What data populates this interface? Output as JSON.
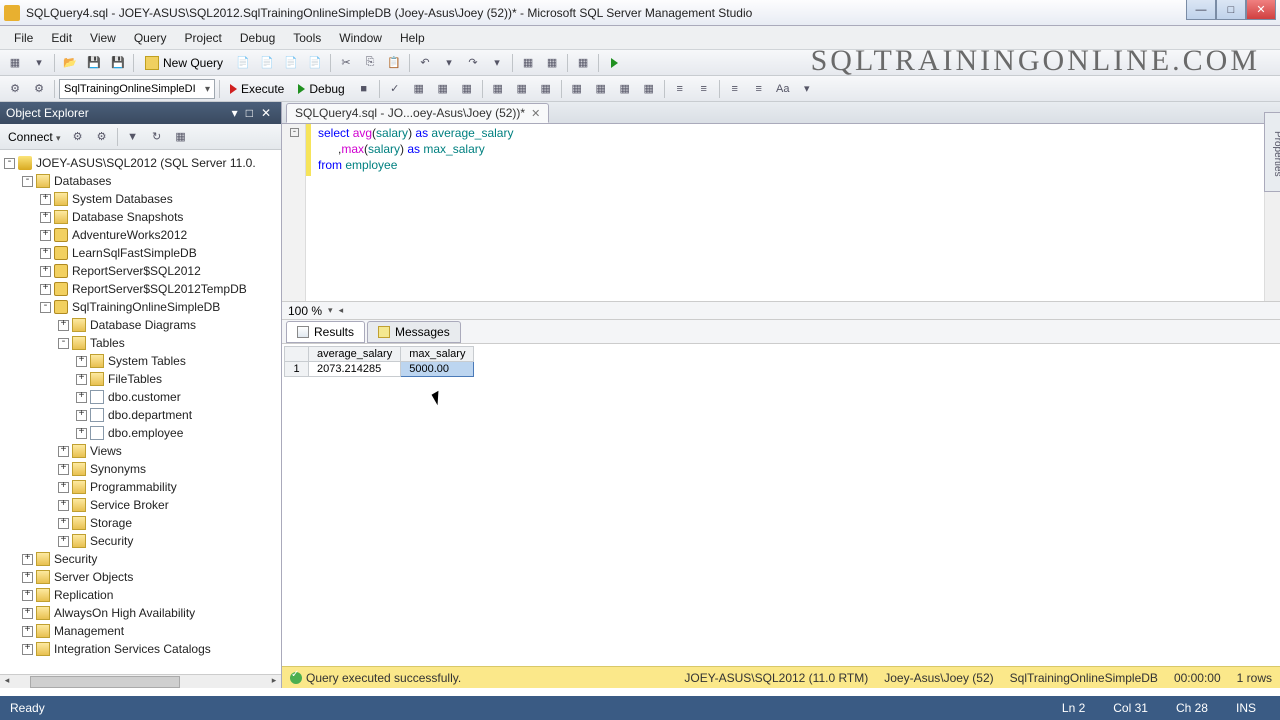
{
  "title": "SQLQuery4.sql - JOEY-ASUS\\SQL2012.SqlTrainingOnlineSimpleDB (Joey-Asus\\Joey (52))* - Microsoft SQL Server Management Studio",
  "menu": {
    "items": [
      "File",
      "Edit",
      "View",
      "Query",
      "Project",
      "Debug",
      "Tools",
      "Window",
      "Help"
    ]
  },
  "toolbar": {
    "new_query": "New Query",
    "db_selected": "SqlTrainingOnlineSimpleDI",
    "execute": "Execute",
    "debug": "Debug"
  },
  "watermark": "SQLTRAININGONLINE.COM",
  "object_explorer": {
    "title": "Object Explorer",
    "connect": "Connect",
    "server": "JOEY-ASUS\\SQL2012 (SQL Server 11.0.",
    "nodes": [
      {
        "depth": 1,
        "exp": "-",
        "ico": "folder",
        "label": "Databases"
      },
      {
        "depth": 2,
        "exp": "+",
        "ico": "folder",
        "label": "System Databases"
      },
      {
        "depth": 2,
        "exp": "+",
        "ico": "folder",
        "label": "Database Snapshots"
      },
      {
        "depth": 2,
        "exp": "+",
        "ico": "db",
        "label": "AdventureWorks2012"
      },
      {
        "depth": 2,
        "exp": "+",
        "ico": "db",
        "label": "LearnSqlFastSimpleDB"
      },
      {
        "depth": 2,
        "exp": "+",
        "ico": "db",
        "label": "ReportServer$SQL2012"
      },
      {
        "depth": 2,
        "exp": "+",
        "ico": "db",
        "label": "ReportServer$SQL2012TempDB"
      },
      {
        "depth": 2,
        "exp": "-",
        "ico": "db",
        "label": "SqlTrainingOnlineSimpleDB"
      },
      {
        "depth": 3,
        "exp": "+",
        "ico": "folder",
        "label": "Database Diagrams"
      },
      {
        "depth": 3,
        "exp": "-",
        "ico": "folder",
        "label": "Tables"
      },
      {
        "depth": 4,
        "exp": "+",
        "ico": "folder",
        "label": "System Tables"
      },
      {
        "depth": 4,
        "exp": "+",
        "ico": "folder",
        "label": "FileTables"
      },
      {
        "depth": 4,
        "exp": "+",
        "ico": "table",
        "label": "dbo.customer"
      },
      {
        "depth": 4,
        "exp": "+",
        "ico": "table",
        "label": "dbo.department"
      },
      {
        "depth": 4,
        "exp": "+",
        "ico": "table",
        "label": "dbo.employee"
      },
      {
        "depth": 3,
        "exp": "+",
        "ico": "folder",
        "label": "Views"
      },
      {
        "depth": 3,
        "exp": "+",
        "ico": "folder",
        "label": "Synonyms"
      },
      {
        "depth": 3,
        "exp": "+",
        "ico": "folder",
        "label": "Programmability"
      },
      {
        "depth": 3,
        "exp": "+",
        "ico": "folder",
        "label": "Service Broker"
      },
      {
        "depth": 3,
        "exp": "+",
        "ico": "folder",
        "label": "Storage"
      },
      {
        "depth": 3,
        "exp": "+",
        "ico": "folder",
        "label": "Security"
      },
      {
        "depth": 1,
        "exp": "+",
        "ico": "folder",
        "label": "Security"
      },
      {
        "depth": 1,
        "exp": "+",
        "ico": "folder",
        "label": "Server Objects"
      },
      {
        "depth": 1,
        "exp": "+",
        "ico": "folder",
        "label": "Replication"
      },
      {
        "depth": 1,
        "exp": "+",
        "ico": "folder",
        "label": "AlwaysOn High Availability"
      },
      {
        "depth": 1,
        "exp": "+",
        "ico": "folder",
        "label": "Management"
      },
      {
        "depth": 1,
        "exp": "+",
        "ico": "folder",
        "label": "Integration Services Catalogs"
      }
    ]
  },
  "editor": {
    "tab": "SQLQuery4.sql - JO...oey-Asus\\Joey (52))*",
    "zoom": "100 %",
    "lines": [
      [
        {
          "t": "select ",
          "c": "kw"
        },
        {
          "t": "avg",
          "c": "fn"
        },
        {
          "t": "(",
          "c": "pl"
        },
        {
          "t": "salary",
          "c": "id"
        },
        {
          "t": ") ",
          "c": "pl"
        },
        {
          "t": "as ",
          "c": "kw"
        },
        {
          "t": "average_salary",
          "c": "id"
        }
      ],
      [
        {
          "t": "      ,",
          "c": "pl"
        },
        {
          "t": "max",
          "c": "fn"
        },
        {
          "t": "(",
          "c": "pl"
        },
        {
          "t": "salary",
          "c": "id"
        },
        {
          "t": ") ",
          "c": "pl"
        },
        {
          "t": "as ",
          "c": "kw"
        },
        {
          "t": "max_salary",
          "c": "id"
        }
      ],
      [
        {
          "t": "from ",
          "c": "kw"
        },
        {
          "t": "employee",
          "c": "id"
        }
      ]
    ]
  },
  "results": {
    "tab_results": "Results",
    "tab_messages": "Messages",
    "columns": [
      "",
      "average_salary",
      "max_salary"
    ],
    "row": {
      "num": "1",
      "avg": "2073.214285",
      "max": "5000.00"
    }
  },
  "query_status": {
    "msg": "Query executed successfully.",
    "server": "JOEY-ASUS\\SQL2012 (11.0 RTM)",
    "user": "Joey-Asus\\Joey (52)",
    "db": "SqlTrainingOnlineSimpleDB",
    "time": "00:00:00",
    "rows": "1 rows"
  },
  "status": {
    "ready": "Ready",
    "ln": "Ln 2",
    "col": "Col 31",
    "ch": "Ch 28",
    "ins": "INS"
  },
  "sidetab": "Properties"
}
